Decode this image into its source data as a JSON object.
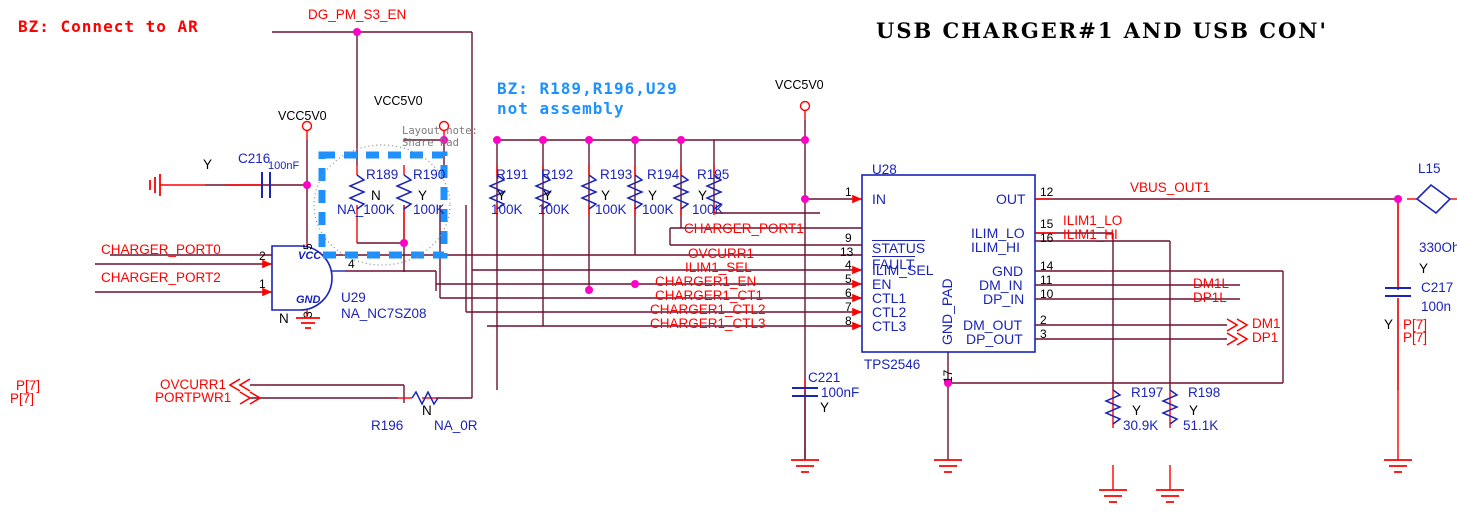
{
  "sheet": {
    "title": "USB CHARGER#1 AND USB CON'",
    "notes": {
      "bz_connect": "BZ: Connect to AR",
      "bz_not_assembly_l1": "BZ: R189,R196,U29",
      "bz_not_assembly_l2": "not assembly",
      "layout_note_l1": "Layout note:",
      "layout_note_l2": "Share Pad"
    },
    "colors": {
      "wire": "#6d1030",
      "pin_stub": "#ff0000",
      "net_label": "#ff0000",
      "component": "#1c24b8",
      "junction": "#ff00c8",
      "highlight_box": "#1e90ff",
      "note_blue": "#1e90ff"
    }
  },
  "power_nets": [
    {
      "name": "VCC5V0",
      "id": "vcc5v0-left"
    },
    {
      "name": "VCC5V0",
      "id": "vcc5v0-mid"
    },
    {
      "name": "VCC5V0",
      "id": "vcc5v0-right"
    }
  ],
  "nets": {
    "dg_pm_s3_en": "DG_PM_S3_EN",
    "charger_port0": "CHARGER_PORT0",
    "charger_port2": "CHARGER_PORT2",
    "charger_port1": "CHARGER_PORT1",
    "ovcurr1": "OVCURR1",
    "ilim1_sel": "ILIM1_SEL",
    "charger1_en": "CHARGER1_EN",
    "charger1_ct1": "CHARGER1_CT1",
    "charger1_ctl2": "CHARGER1_CTL2",
    "charger1_ctl3": "CHARGER1_CTL3",
    "vbus_out1": "VBUS_OUT1",
    "ilim1_lo": "ILIM1_LO",
    "ilim1_hi": "ILIM1_HI",
    "dm1l": "DM1L",
    "dp1l": "DP1L",
    "dm1": "DM1",
    "dp1": "DP1",
    "ovcurr1_port": "OVCURR1",
    "portpwr1_port": "PORTPWR1",
    "page_ref_1": "P[7]",
    "page_ref_2": "P[7]",
    "page_ref_3": "P[7]",
    "page_ref_4": "P[7]"
  },
  "u28": {
    "ref": "U28",
    "part": "TPS2546",
    "left_pins": [
      {
        "num": "1",
        "label": "IN",
        "overline": false,
        "arrow": true
      },
      {
        "num": "9",
        "label": "STATUS",
        "overline": true,
        "arrow": false
      },
      {
        "num": "13",
        "label": "FAULT",
        "overline": true,
        "arrow": false
      },
      {
        "num": "4",
        "label": "ILIM_SEL",
        "overline": false,
        "arrow": true
      },
      {
        "num": "5",
        "label": "EN",
        "overline": false,
        "arrow": true
      },
      {
        "num": "6",
        "label": "CTL1",
        "overline": false,
        "arrow": true
      },
      {
        "num": "7",
        "label": "CTL2",
        "overline": false,
        "arrow": true
      },
      {
        "num": "8",
        "label": "CTL3",
        "overline": false,
        "arrow": true
      }
    ],
    "right_pins": [
      {
        "num": "12",
        "label": "OUT"
      },
      {
        "num": "15",
        "label": "ILIM_LO"
      },
      {
        "num": "16",
        "label": "ILIM_HI"
      },
      {
        "num": "14",
        "label": "GND"
      },
      {
        "num": "11",
        "label": "DM_IN"
      },
      {
        "num": "10",
        "label": "DP_IN"
      },
      {
        "num": "2",
        "label": "DM_OUT"
      },
      {
        "num": "3",
        "label": "DP_OUT"
      }
    ],
    "center_pin": {
      "num": "17",
      "label": "GND_PAD"
    }
  },
  "u29": {
    "ref": "U29",
    "part": "NA_NC7SZ08",
    "pins": [
      {
        "num": "2",
        "label": ""
      },
      {
        "num": "1",
        "label": ""
      },
      {
        "num": "4",
        "label": ""
      },
      {
        "num": "5",
        "label": "VCC"
      },
      {
        "num": "3",
        "label": "GND"
      }
    ],
    "gnd_flag": "N"
  },
  "components": [
    {
      "ref": "C216",
      "value": "100nF",
      "fit": "Y",
      "type": "cap"
    },
    {
      "ref": "C221",
      "value": "100nF",
      "fit": "Y",
      "type": "cap"
    },
    {
      "ref": "C217",
      "value": "100n",
      "fit": "Y",
      "type": "cap"
    },
    {
      "ref": "R189",
      "value": "NA_100K",
      "fit": "N",
      "type": "res"
    },
    {
      "ref": "R190",
      "value": "100K",
      "fit": "Y",
      "type": "res"
    },
    {
      "ref": "R191",
      "value": "100K",
      "fit": "Y",
      "type": "res"
    },
    {
      "ref": "R192",
      "value": "100K",
      "fit": "Y",
      "type": "res"
    },
    {
      "ref": "R193",
      "value": "100K",
      "fit": "Y",
      "type": "res"
    },
    {
      "ref": "R194",
      "value": "100K",
      "fit": "Y",
      "type": "res"
    },
    {
      "ref": "R195",
      "value": "100K",
      "fit": "Y",
      "type": "res"
    },
    {
      "ref": "R196",
      "value": "NA_0R",
      "fit": "N",
      "type": "res-h"
    },
    {
      "ref": "R197",
      "value": "30.9K",
      "fit": "Y",
      "type": "res"
    },
    {
      "ref": "R198",
      "value": "51.1K",
      "fit": "Y",
      "type": "res"
    },
    {
      "ref": "L15",
      "value": "330Oh",
      "fit": "Y",
      "type": "bead"
    }
  ],
  "resistor_bank": [
    {
      "ref": "R189",
      "fit": "N",
      "value": "NA_100K"
    },
    {
      "ref": "R190",
      "fit": "Y",
      "value": "100K"
    },
    {
      "ref": "R191",
      "fit": "Y",
      "value": "100K"
    },
    {
      "ref": "R192",
      "fit": "Y",
      "value": "100K"
    },
    {
      "ref": "R193",
      "fit": "Y",
      "value": "100K"
    },
    {
      "ref": "R194",
      "fit": "Y",
      "value": "100K"
    },
    {
      "ref": "R195",
      "fit": "Y",
      "value": "100K"
    }
  ]
}
